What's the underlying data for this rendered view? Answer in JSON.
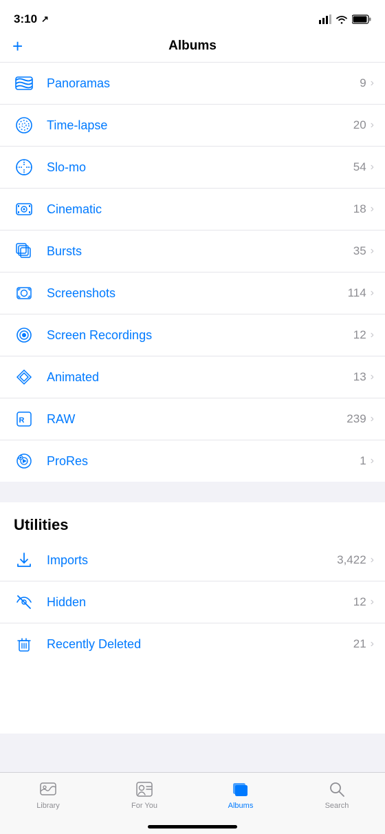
{
  "statusBar": {
    "time": "3:10",
    "locationIcon": "↗"
  },
  "header": {
    "addButton": "+",
    "title": "Albums"
  },
  "mediaItems": [
    {
      "id": "panoramas",
      "label": "Panoramas",
      "count": "9",
      "iconType": "panorama"
    },
    {
      "id": "timelapse",
      "label": "Time-lapse",
      "count": "20",
      "iconType": "timelapse"
    },
    {
      "id": "slomo",
      "label": "Slo-mo",
      "count": "54",
      "iconType": "slomo"
    },
    {
      "id": "cinematic",
      "label": "Cinematic",
      "count": "18",
      "iconType": "cinematic"
    },
    {
      "id": "bursts",
      "label": "Bursts",
      "count": "35",
      "iconType": "bursts"
    },
    {
      "id": "screenshots",
      "label": "Screenshots",
      "count": "114",
      "iconType": "screenshots"
    },
    {
      "id": "screenrecordings",
      "label": "Screen Recordings",
      "count": "12",
      "iconType": "screenrecordings"
    },
    {
      "id": "animated",
      "label": "Animated",
      "count": "13",
      "iconType": "animated"
    },
    {
      "id": "raw",
      "label": "RAW",
      "count": "239",
      "iconType": "raw"
    },
    {
      "id": "prores",
      "label": "ProRes",
      "count": "1",
      "iconType": "prores"
    }
  ],
  "utilitiesSection": {
    "header": "Utilities",
    "items": [
      {
        "id": "imports",
        "label": "Imports",
        "count": "3,422",
        "iconType": "imports"
      },
      {
        "id": "hidden",
        "label": "Hidden",
        "count": "12",
        "iconType": "hidden"
      },
      {
        "id": "recentlydeleted",
        "label": "Recently Deleted",
        "count": "21",
        "iconType": "recentlydeleted"
      }
    ]
  },
  "tabBar": {
    "items": [
      {
        "id": "library",
        "label": "Library",
        "active": false
      },
      {
        "id": "foryou",
        "label": "For You",
        "active": false
      },
      {
        "id": "albums",
        "label": "Albums",
        "active": true
      },
      {
        "id": "search",
        "label": "Search",
        "active": false
      }
    ]
  }
}
